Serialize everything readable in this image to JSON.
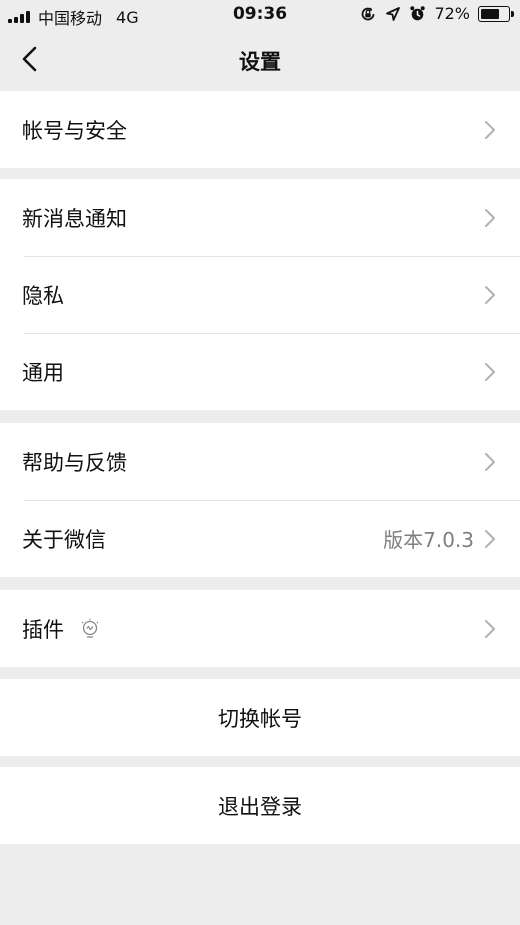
{
  "status_bar": {
    "carrier": "中国移动",
    "network": "4G",
    "time": "09:36",
    "battery_percent": "72%",
    "battery_level": 0.72,
    "icons": [
      "signal-icon",
      "lock-rotation-icon",
      "location-arrow-icon",
      "alarm-icon",
      "battery-icon"
    ]
  },
  "navbar": {
    "title": "设置",
    "back_icon": "chevron-left-icon"
  },
  "groups": {
    "account": {
      "account_security": "帐号与安全"
    },
    "general": {
      "new_message_notify": "新消息通知",
      "privacy": "隐私",
      "general": "通用"
    },
    "help": {
      "help_feedback": "帮助与反馈",
      "about_wechat": "关于微信",
      "version": "版本7.0.3"
    },
    "plugins": {
      "plugins": "插件",
      "plugin_icon": "lightbulb-icon"
    },
    "switch_account": "切换帐号",
    "logout": "退出登录"
  },
  "colors": {
    "background": "#ededed",
    "card": "#ffffff",
    "divider": "#e5e5e5",
    "secondary_text": "#7f7f7f",
    "chevron": "#b2b2b2"
  }
}
